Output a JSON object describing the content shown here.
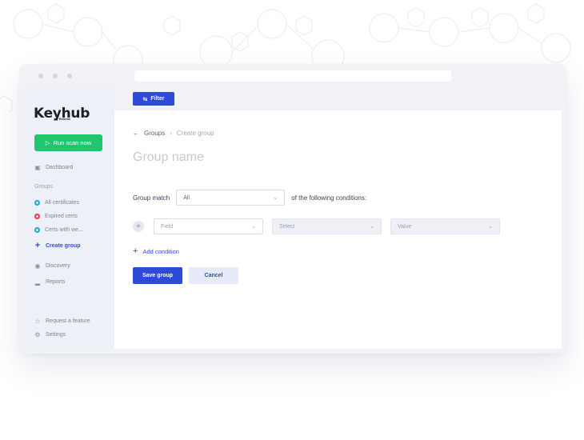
{
  "app": {
    "logo": "Keyhub",
    "logo_sub": "by Remme"
  },
  "sidebar": {
    "scan_button": "Run scan now",
    "dashboard": "Dashboard",
    "groups_heading": "Groups",
    "groups": [
      {
        "label": "All certificates",
        "color": "#1aa9c9"
      },
      {
        "label": "Expired certs",
        "color": "#f0334a"
      },
      {
        "label": "Certs with we...",
        "color": "#1aa9c9"
      }
    ],
    "create_group": "Create group",
    "discovery": "Discovery",
    "reports": "Reports",
    "request_feature": "Request a feature",
    "settings": "Settings"
  },
  "toolbar": {
    "filter_label": "Filter"
  },
  "breadcrumb": {
    "parent": "Groups",
    "current": "Create group"
  },
  "form": {
    "title_placeholder": "Group name",
    "match_label": "Group match",
    "match_value": "All",
    "match_suffix": "of the following conditions:",
    "field_placeholder": "Field",
    "operator_placeholder": "Select",
    "value_placeholder": "Value",
    "add_condition": "Add condition",
    "save": "Save group",
    "cancel": "Cancel"
  },
  "colors": {
    "accent": "#2d4bd6",
    "scan": "#23c46e"
  }
}
